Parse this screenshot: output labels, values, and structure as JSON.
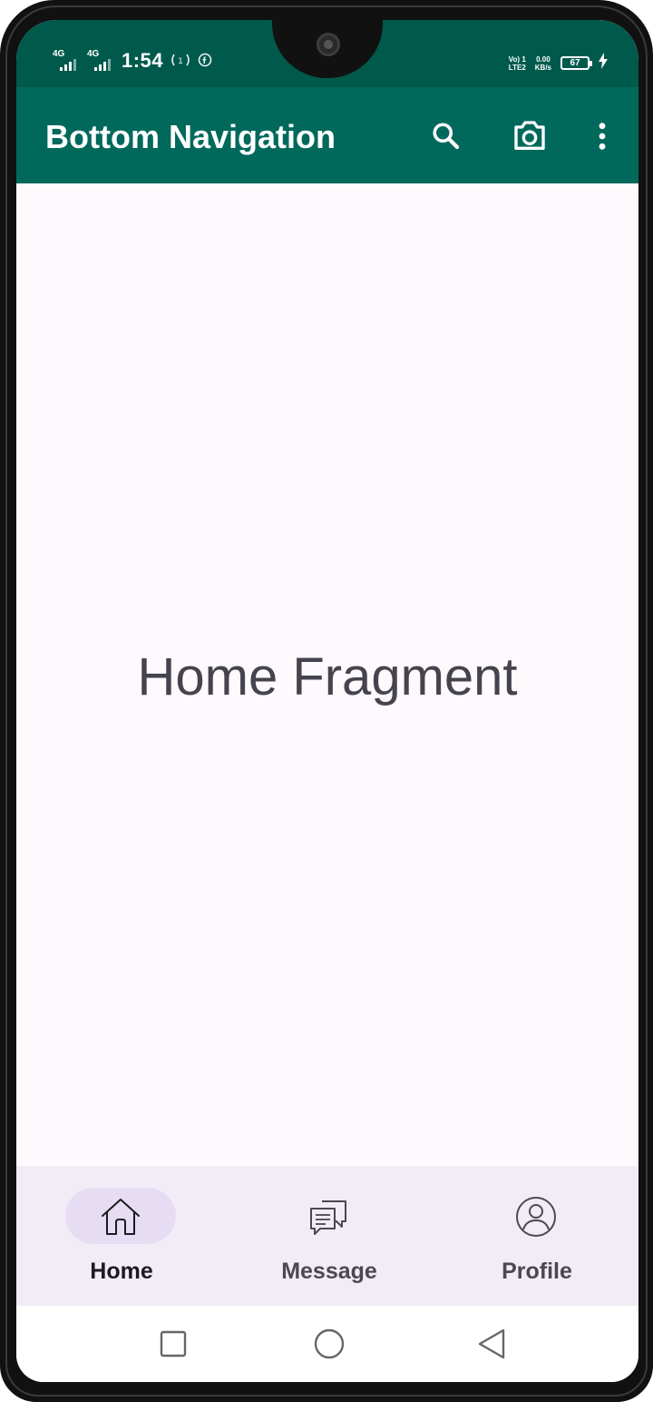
{
  "status_bar": {
    "network_1": "4G",
    "network_2": "4G",
    "time": "1:54",
    "volte_top": "Vo) 1",
    "volte_bottom": "LTE2",
    "speed_value": "0.00",
    "speed_unit": "KB/s",
    "battery_level": "67"
  },
  "toolbar": {
    "title": "Bottom Navigation",
    "background": "#00695c"
  },
  "content": {
    "text": "Home Fragment"
  },
  "bottom_nav": {
    "items": [
      {
        "label": "Home",
        "icon": "home-icon",
        "active": true
      },
      {
        "label": "Message",
        "icon": "message-icon",
        "active": false
      },
      {
        "label": "Profile",
        "icon": "profile-icon",
        "active": false
      }
    ],
    "active_indicator_color": "#e6ddf4",
    "background": "#f2ecf6"
  },
  "system_nav": {
    "icons": [
      "recents-icon",
      "home-circle-icon",
      "back-icon"
    ]
  }
}
